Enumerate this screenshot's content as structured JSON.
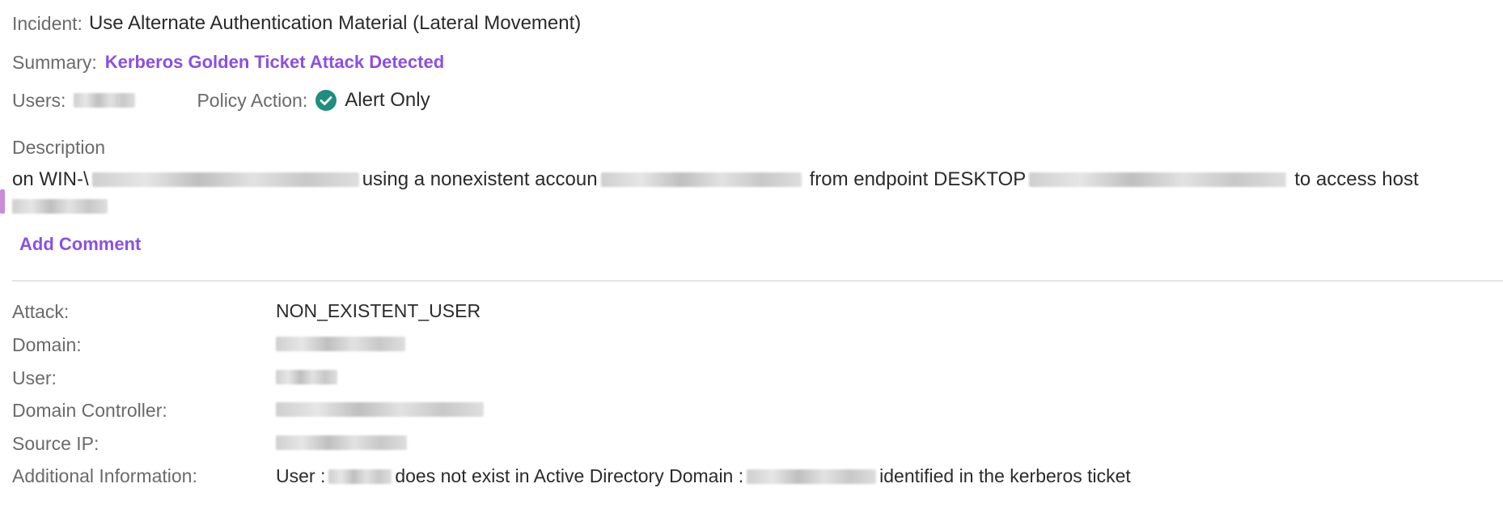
{
  "incident": {
    "label": "Incident:",
    "value": "Use Alternate Authentication Material (Lateral Movement)"
  },
  "summary": {
    "label": "Summary:",
    "value": "Kerberos Golden Ticket Attack Detected"
  },
  "users": {
    "label": "Users:"
  },
  "policy_action": {
    "label": "Policy Action:",
    "value": "Alert Only",
    "icon": "check-circle-icon",
    "icon_color": "#1f8e7e"
  },
  "description": {
    "label": "Description",
    "part1": "on WIN-\\",
    "part2": "using a nonexistent accoun",
    "part3": "from endpoint DESKTOP",
    "part4": "to access host"
  },
  "add_comment": {
    "label": "Add Comment"
  },
  "details": {
    "attack_label": "Attack:",
    "attack_value": "NON_EXISTENT_USER",
    "domain_label": "Domain:",
    "user_label": "User:",
    "domain_controller_label": "Domain Controller:",
    "source_ip_label": "Source IP:",
    "additional_info_label": "Additional Information:",
    "additional_info_part1": "User :",
    "additional_info_part2": "does not exist in Active Directory Domain :",
    "additional_info_part3": "identified in the kerberos ticket"
  },
  "colors": {
    "accent": "#8b4fe4",
    "success": "#1f8e7e"
  }
}
